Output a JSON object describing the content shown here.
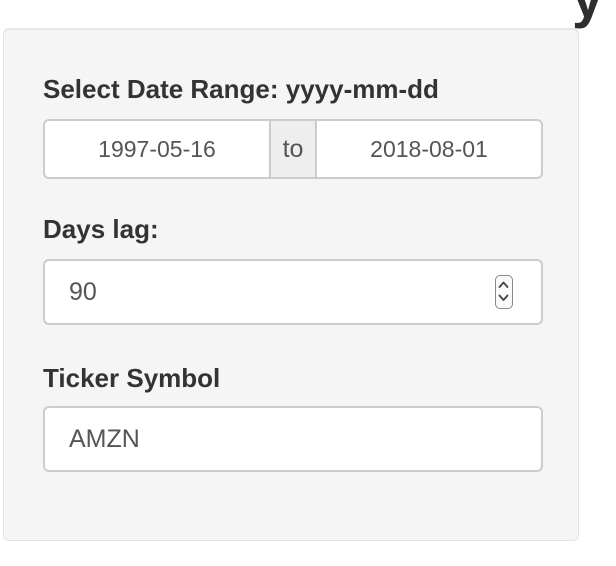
{
  "date_range": {
    "label": "Select Date Range: yyyy-mm-dd",
    "start": "1997-05-16",
    "separator": "to",
    "end": "2018-08-01"
  },
  "days_lag": {
    "label": "Days lag:",
    "value": "90"
  },
  "ticker": {
    "label": "Ticker Symbol",
    "value": "AMZN"
  },
  "icons": {
    "spinner": "up-down-spinner-icon"
  },
  "colors": {
    "panel_bg": "#f5f5f5",
    "border": "#cccccc",
    "text": "#333333",
    "input_text": "#555555"
  }
}
